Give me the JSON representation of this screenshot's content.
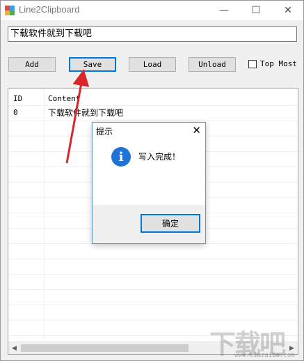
{
  "window": {
    "title": "Line2Clipboard",
    "minimize_glyph": "—",
    "maximize_glyph": "☐",
    "close_glyph": "✕"
  },
  "input": {
    "value": "下载软件就到下载吧"
  },
  "toolbar": {
    "add_label": "Add",
    "save_label": "Save",
    "load_label": "Load",
    "unload_label": "Unload",
    "top_most_label": "Top Most",
    "top_most_checked": false
  },
  "list": {
    "columns": [
      "ID",
      "Content"
    ],
    "rows": [
      {
        "id": "0",
        "content": "下载软件就到下载吧"
      }
    ]
  },
  "dialog": {
    "title": "提示",
    "close_glyph": "✕",
    "icon": "info-icon",
    "icon_glyph": "i",
    "message": "写入完成！",
    "ok_label": "确定"
  },
  "watermark": {
    "main": "下载吧",
    "sub": "www.xiazaiba.com"
  },
  "colors": {
    "accent": "#0078d7",
    "info_icon": "#1e74d8",
    "annotation_arrow": "#d9262b"
  }
}
